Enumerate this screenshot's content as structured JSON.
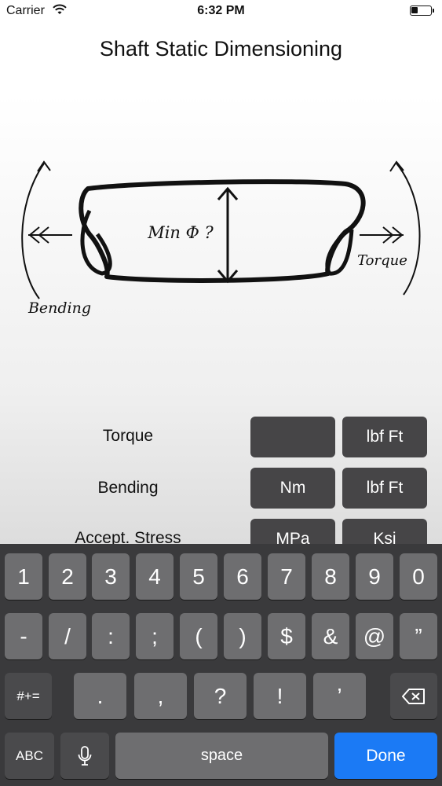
{
  "status_bar": {
    "carrier": "Carrier",
    "time": "6:32 PM"
  },
  "title": "Shaft Static Dimensioning",
  "diagram": {
    "min_label": "Min Φ ?",
    "bending_label": "Bending",
    "torque_label": "Torque"
  },
  "rows": [
    {
      "label": "Torque",
      "unit_left": "",
      "unit_right": "lbf Ft"
    },
    {
      "label": "Bending",
      "unit_left": "Nm",
      "unit_right": "lbf Ft"
    },
    {
      "label": "Accept. Stress",
      "unit_left": "MPa",
      "unit_right": "Ksi"
    }
  ],
  "keyboard": {
    "row1": [
      "1",
      "2",
      "3",
      "4",
      "5",
      "6",
      "7",
      "8",
      "9",
      "0"
    ],
    "row2": [
      "-",
      "/",
      ":",
      ";",
      "(",
      ")",
      "$",
      "&",
      "@",
      "”"
    ],
    "row3": [
      ".",
      ",",
      "?",
      "!",
      "’"
    ],
    "mode_symbols": "#+=",
    "mode_abc": "ABC",
    "space": "space",
    "done": "Done"
  }
}
